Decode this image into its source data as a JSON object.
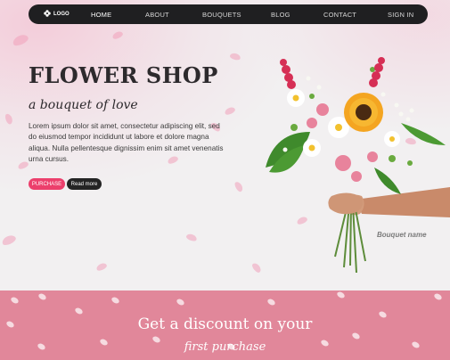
{
  "nav": {
    "logo_label": "LOGO",
    "logo_icon": "flower-icon",
    "items": [
      {
        "label": "HOME",
        "active": true
      },
      {
        "label": "ABOUT",
        "active": false
      },
      {
        "label": "BOUQUETS",
        "active": false
      },
      {
        "label": "BLOG",
        "active": false
      },
      {
        "label": "CONTACT",
        "active": false
      },
      {
        "label": "SIGN IN",
        "active": false
      }
    ]
  },
  "hero": {
    "title": "FLOWER SHOP",
    "subtitle": "a bouquet of love",
    "body": "Lorem ipsum dolor sit amet, consectetur adipiscing elit, sed do eiusmod tempor incididunt ut labore et dolore magna aliqua. Nulla pellentesque dignissim enim sit amet venenatis urna cursus.",
    "purchase_label": "PURCHASE",
    "read_more_label": "Read more",
    "bouquet_caption": "Bouquet name"
  },
  "banner": {
    "title": "Get a discount on your",
    "subtitle": "first purchase"
  },
  "colors": {
    "nav_bg": "#1f1f21",
    "accent": "#ec3f6c",
    "banner_bg": "#e1879a",
    "hero_bg": "#f2f0f1"
  }
}
